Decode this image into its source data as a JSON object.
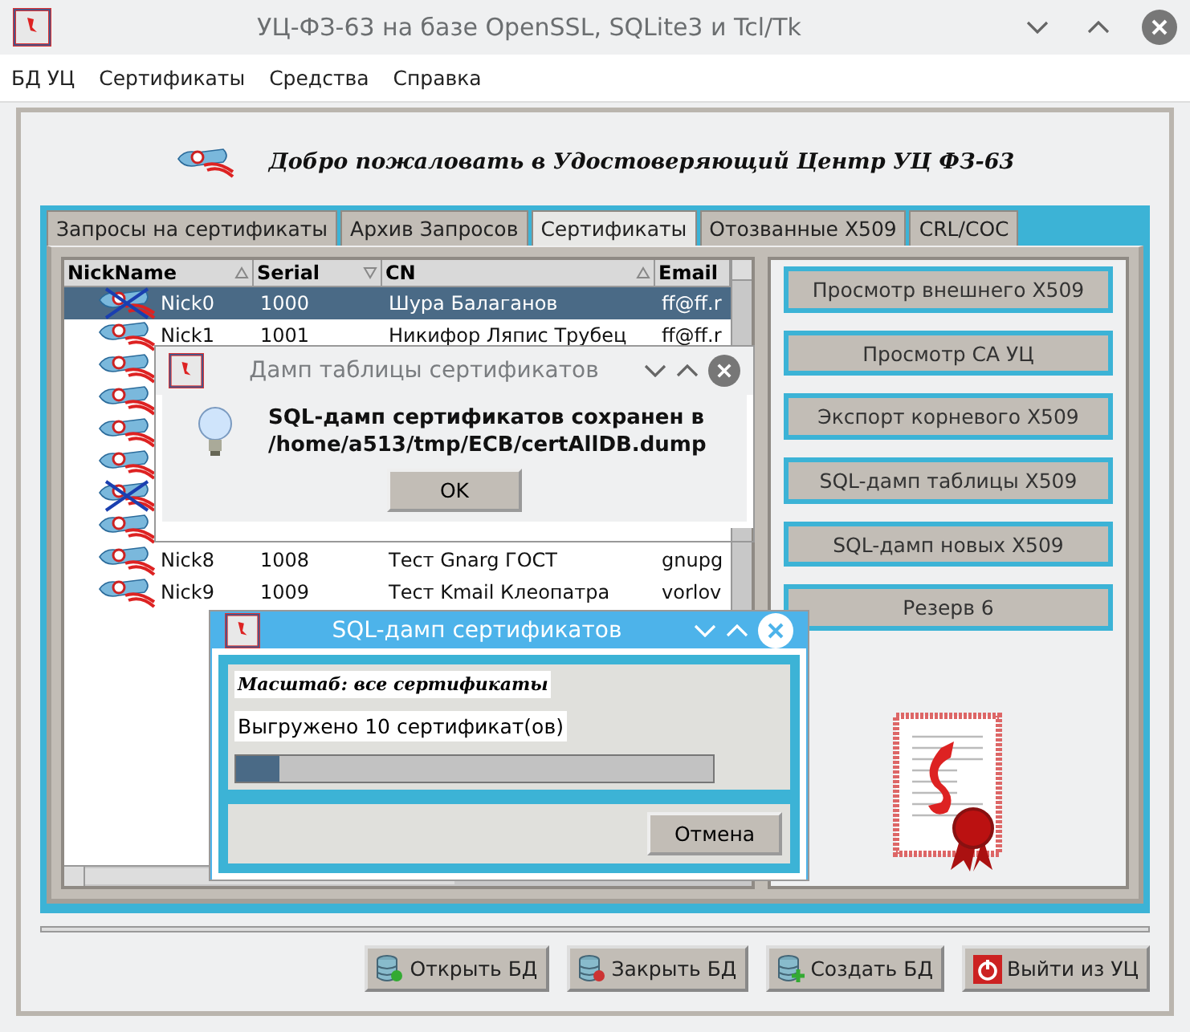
{
  "window": {
    "title": "УЦ-ФЗ-63 на базе OpenSSL, SQLite3 и Tcl/Tk"
  },
  "menu": [
    "БД УЦ",
    "Сертификаты",
    "Средства",
    "Справка"
  ],
  "heading": "Добро пожаловать в Удостоверяющий Центр УЦ ФЗ-63",
  "tabs": [
    {
      "label": "Запросы на сертификаты",
      "selected": false
    },
    {
      "label": "Архив Запросов",
      "selected": false
    },
    {
      "label": "Сертификаты",
      "selected": true
    },
    {
      "label": "Отозванные X509",
      "selected": false
    },
    {
      "label": "CRL/COC",
      "selected": false
    }
  ],
  "table": {
    "columns": [
      {
        "label": "NickName",
        "kind": "ascending"
      },
      {
        "label": "Serial",
        "kind": "descending"
      },
      {
        "label": "CN",
        "kind": "ascending"
      },
      {
        "label": "Email",
        "kind": "plain"
      }
    ],
    "rows": [
      {
        "kind": "revoked",
        "selected": true,
        "cells": [
          "Nick0",
          "1000",
          "Шура Балаганов",
          "ff@ff.r"
        ]
      },
      {
        "kind": "valid",
        "selected": false,
        "cells": [
          "Nick1",
          "1001",
          "Никифор Ляпис Трубец",
          "ff@ff.r"
        ]
      },
      {
        "kind": "valid",
        "selected": false
      },
      {
        "kind": "valid",
        "selected": false
      },
      {
        "kind": "valid",
        "selected": false
      },
      {
        "kind": "valid",
        "selected": false
      },
      {
        "kind": "revoked",
        "selected": false
      },
      {
        "kind": "valid",
        "selected": false
      },
      {
        "kind": "valid",
        "selected": false,
        "cells": [
          "Nick8",
          "1008",
          "Тест Gnarg ГОСТ",
          "gnupg"
        ]
      },
      {
        "kind": "valid",
        "selected": false,
        "cells": [
          "Nick9",
          "1009",
          "Тест Kmail Клеопатра",
          "vorlov"
        ]
      }
    ]
  },
  "actions": [
    "Просмотр внешнего X509",
    "Просмотр CA УЦ",
    "Экспорт корневого X509",
    "SQL-дамп таблицы X509",
    "SQL-дамп новых X509",
    "Резерв 6"
  ],
  "bottom_buttons": [
    {
      "label": "Открыть БД",
      "kind": "open"
    },
    {
      "label": "Закрыть БД",
      "kind": "close"
    },
    {
      "label": "Создать БД",
      "kind": "create"
    },
    {
      "label": "Выйти из УЦ",
      "kind": "exit"
    }
  ],
  "message_dialog": {
    "title": "Дамп таблицы сертификатов",
    "lines": [
      "SQL-дамп сертификатов сохранен в",
      "/home/a513/tmp/ECB/certAllDB.dump"
    ],
    "button": "OK"
  },
  "progress_dialog": {
    "title": "SQL-дамп сертификатов",
    "scope": "Масштаб: все сертификаты",
    "status": "Выгружено 10 сертификат(ов)",
    "level": 0.09,
    "button": "Отмена"
  }
}
